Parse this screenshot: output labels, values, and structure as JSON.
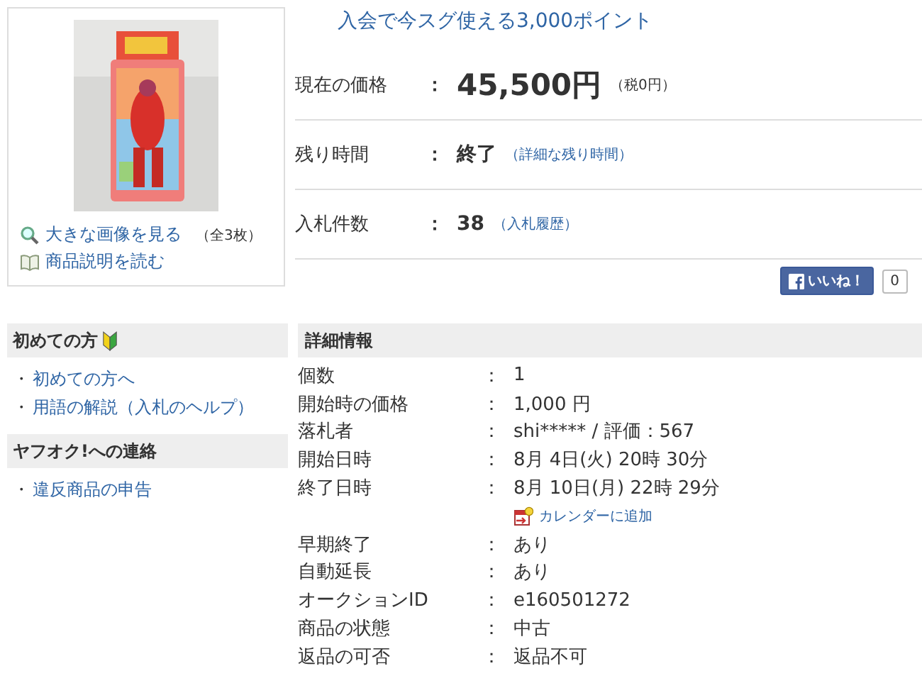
{
  "image_panel": {
    "links": [
      {
        "kind": "zoom",
        "label": "大きな画像を見る",
        "note": "（全3枚）"
      },
      {
        "kind": "book",
        "label": "商品説明を読む"
      }
    ]
  },
  "promo": "入会で今スグ使える3,000ポイント",
  "summary": [
    {
      "kind": "price",
      "label": "現在の価格",
      "colon": "：",
      "value": "45,500円",
      "note": "（税0円）"
    },
    {
      "kind": "time",
      "label": "残り時間",
      "colon": "：",
      "value": "終了",
      "link": "（詳細な残り時間）"
    },
    {
      "kind": "bids",
      "label": "入札件数",
      "colon": "：",
      "value": "38",
      "link": "（入札履歴）"
    }
  ],
  "like": {
    "label": "いいね！",
    "count": "0"
  },
  "sidebar": [
    {
      "title": "初めての方",
      "beginner_mark": true,
      "items": [
        {
          "bullet": "・",
          "label": "初めての方へ"
        },
        {
          "bullet": "・",
          "label": "用語の解説（入札のヘルプ）"
        }
      ]
    },
    {
      "title": "ヤフオク!への連絡",
      "beginner_mark": false,
      "items": [
        {
          "bullet": "・",
          "label": "違反商品の申告"
        }
      ]
    }
  ],
  "details": {
    "title": "詳細情報",
    "rows": [
      {
        "label": "個数",
        "colon": "：",
        "value": "1"
      },
      {
        "label": "開始時の価格",
        "colon": "：",
        "value": "1,000 円"
      },
      {
        "label": "落札者",
        "colon": "：",
        "value": "shi***** / 評価：567"
      },
      {
        "label": "開始日時",
        "colon": "：",
        "value": "8月 4日(火) 20時 30分"
      },
      {
        "label": "終了日時",
        "colon": "：",
        "value": "8月 10日(月) 22時 29分",
        "link": "カレンダーに追加"
      },
      {
        "label": "早期終了",
        "colon": "：",
        "value": "あり"
      },
      {
        "label": "自動延長",
        "colon": "：",
        "value": "あり"
      },
      {
        "label": "オークションID",
        "colon": "：",
        "value": "e160501272"
      },
      {
        "label": "商品の状態",
        "colon": "：",
        "value": "中古"
      },
      {
        "label": "返品の可否",
        "colon": "：",
        "value": "返品不可"
      }
    ]
  }
}
